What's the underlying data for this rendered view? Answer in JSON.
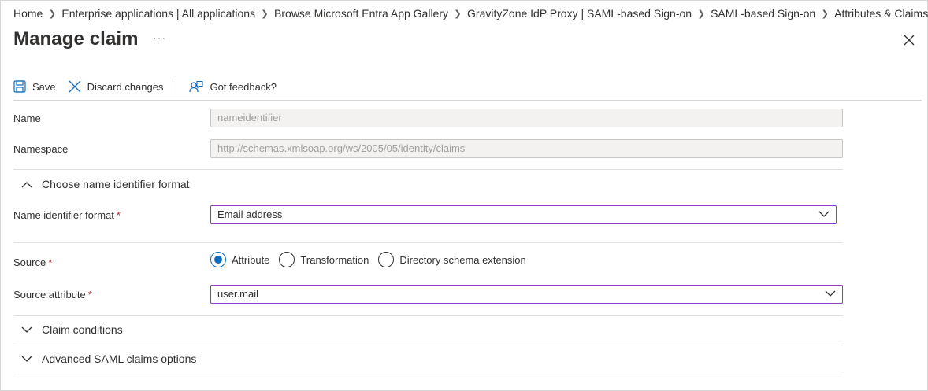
{
  "breadcrumb": [
    {
      "label": "Home"
    },
    {
      "label": "Enterprise applications | All applications"
    },
    {
      "label": "Browse Microsoft Entra App Gallery"
    },
    {
      "label": "GravityZone IdP Proxy | SAML-based Sign-on"
    },
    {
      "label": "SAML-based Sign-on"
    },
    {
      "label": "Attributes & Claims"
    }
  ],
  "page": {
    "title": "Manage claim",
    "more_label": "···"
  },
  "toolbar": {
    "save_label": "Save",
    "discard_label": "Discard changes",
    "feedback_label": "Got feedback?"
  },
  "form": {
    "name_label": "Name",
    "name_value": "nameidentifier",
    "namespace_label": "Namespace",
    "namespace_value": "http://schemas.xmlsoap.org/ws/2005/05/identity/claims",
    "nameid_section_label": "Choose name identifier format",
    "nameid_format_label": "Name identifier format",
    "nameid_format_value": "Email address",
    "source_label": "Source",
    "source_options": [
      {
        "label": "Attribute",
        "selected": true
      },
      {
        "label": "Transformation",
        "selected": false
      },
      {
        "label": "Directory schema extension",
        "selected": false
      }
    ],
    "source_attribute_label": "Source attribute",
    "source_attribute_value": "user.mail",
    "required_mark": "*"
  },
  "sections": {
    "claim_conditions": "Claim conditions",
    "advanced_options": "Advanced SAML claims options"
  },
  "colors": {
    "accent": "#0f6cbd",
    "focus_border": "#8a3ec7",
    "required": "#a4262c"
  }
}
